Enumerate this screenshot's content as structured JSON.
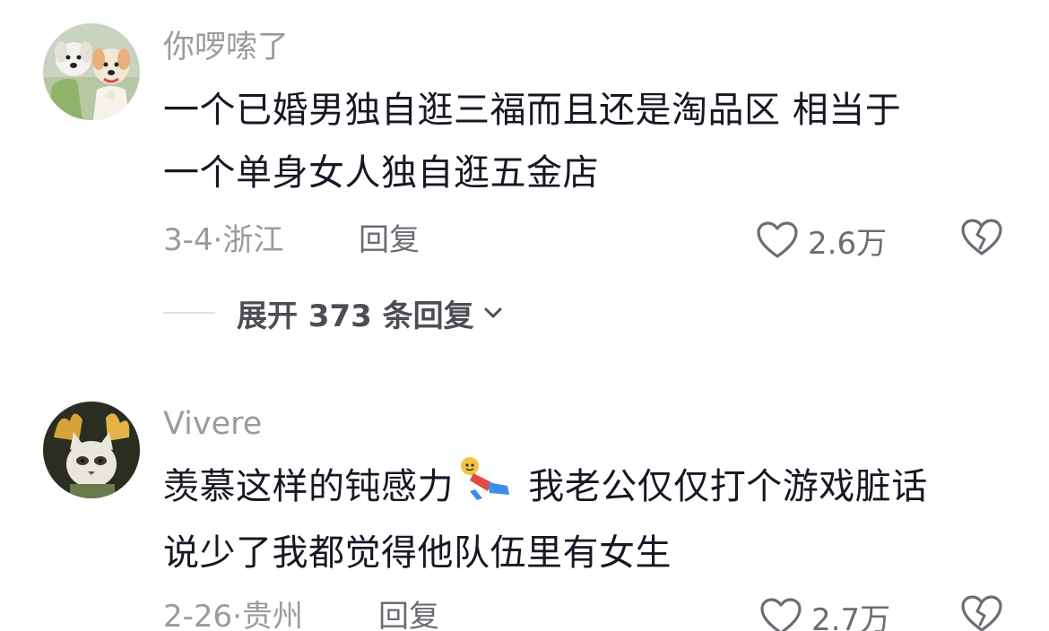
{
  "comments": [
    {
      "username": "你啰嗦了",
      "avatar_icon": "two-dogs-avatar",
      "content_line1": "一个已婚男独自逛三福而且还是淘品区  相当于",
      "content_line2": "一个单身女人独自逛五金店",
      "date": "3-4·浙江",
      "reply_label": "回复",
      "like_count": "2.6万",
      "like_icon": "heart-outline-icon",
      "dislike_icon": "broken-heart-icon"
    },
    {
      "username": "Vivere",
      "avatar_icon": "cat-fire-avatar",
      "content_line1_a": "羡慕这样的钝感力",
      "content_emoji": "sliding-kid-emoji",
      "content_line1_b": " 我老公仅仅打个游戏脏话",
      "content_line2": "说少了我都觉得他队伍里有女生",
      "date": "2-26·贵州",
      "reply_label": "回复",
      "like_count": "2.7万",
      "like_icon": "heart-outline-icon",
      "dislike_icon": "broken-heart-icon"
    }
  ],
  "expand_replies": {
    "label": "展开 373 条回复",
    "icon": "chevron-down-icon"
  },
  "colors": {
    "text_primary": "#161823",
    "text_secondary": "#9b9b9f",
    "action_text": "#6b6c74"
  }
}
